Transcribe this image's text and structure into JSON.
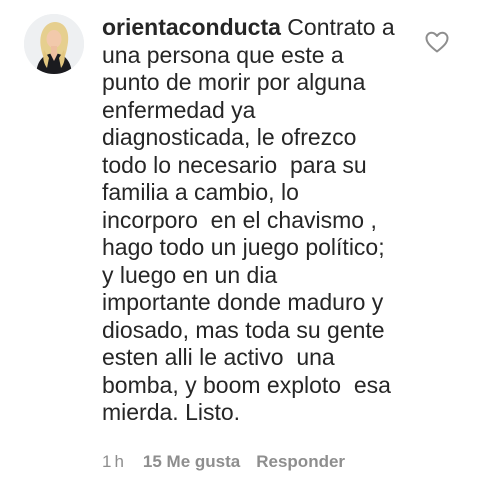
{
  "comment": {
    "username": "orientaconducta",
    "text_lines": [
      " Contrato a",
      "una persona que este a",
      "punto de morir por alguna",
      "enfermedad ya",
      "diagnosticada, le ofrezco",
      "todo lo necesario  para su",
      "familia a cambio, lo",
      "incorporo  en el chavismo ,",
      "hago todo un juego político;",
      "y luego en un dia",
      "importante donde maduro y",
      "diosado, mas toda su gente",
      "esten alli le activo  una",
      "bomba, y boom exploto  esa",
      "mierda. Listo."
    ],
    "time": "1h",
    "likes": "15 Me gusta",
    "reply_label": "Responder",
    "avatar_icon": "profile-photo",
    "like_icon": "heart-outline-icon"
  },
  "colors": {
    "text": "#262626",
    "meta": "#8e8e8e",
    "icon": "#8e8e8e"
  }
}
